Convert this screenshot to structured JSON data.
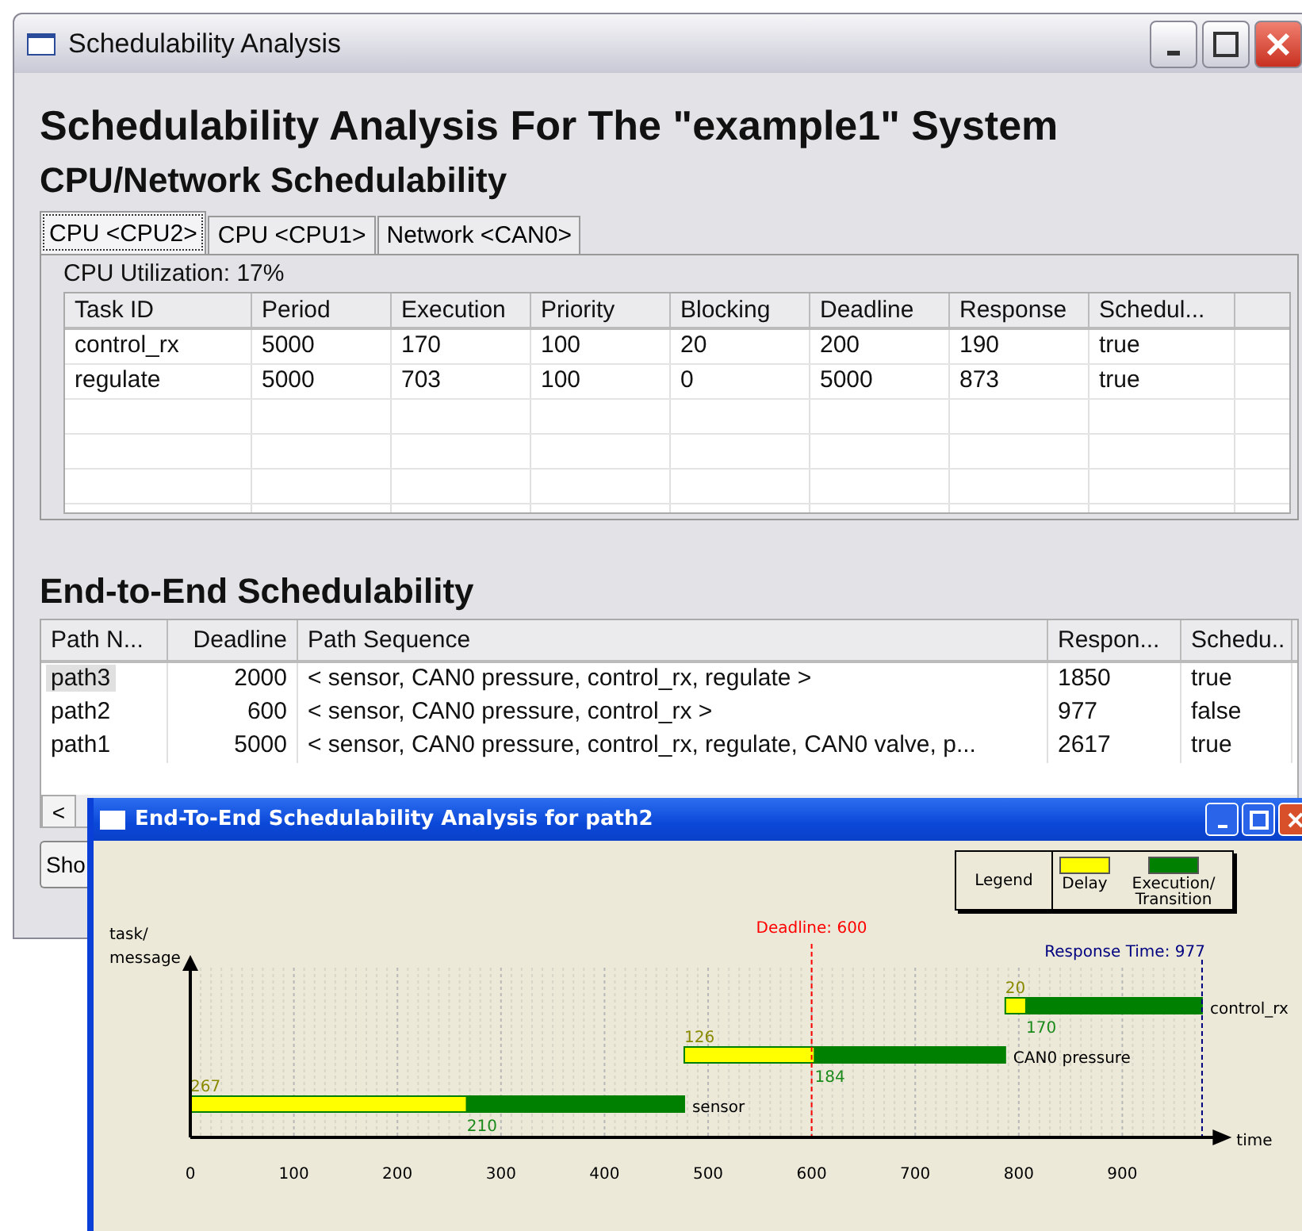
{
  "main_window": {
    "title": "Schedulability Analysis",
    "heading": "Schedulability Analysis For The \"example1\" System",
    "subheading": "CPU/Network Schedulability",
    "tabs": [
      {
        "label": "CPU <CPU2>",
        "selected": true
      },
      {
        "label": "CPU <CPU1>",
        "selected": false
      },
      {
        "label": "Network <CAN0>",
        "selected": false
      }
    ],
    "utilization": "CPU Utilization: 17%",
    "task_table": {
      "columns": [
        "Task ID",
        "Period",
        "Execution",
        "Priority",
        "Blocking",
        "Deadline",
        "Response",
        "Schedul..."
      ],
      "rows": [
        [
          "control_rx",
          "5000",
          "170",
          "100",
          "20",
          "200",
          "190",
          "true"
        ],
        [
          "regulate",
          "5000",
          "703",
          "100",
          "0",
          "5000",
          "873",
          "true"
        ]
      ]
    },
    "e2e_heading": "End-to-End Schedulability",
    "path_table": {
      "columns": [
        "Path N...",
        "Deadline",
        "Path Sequence",
        "Respon...",
        "Schedu.."
      ],
      "rows": [
        {
          "cells": [
            "path3",
            "2000",
            "< sensor, CAN0 pressure, control_rx, regulate >",
            "1850",
            "true"
          ],
          "selected": true
        },
        {
          "cells": [
            "path2",
            "600",
            "< sensor, CAN0 pressure, control_rx >",
            "977",
            "false"
          ],
          "selected": false
        },
        {
          "cells": [
            "path1",
            "5000",
            "< sensor, CAN0 pressure, control_rx, regulate, CAN0 valve, p...",
            "2617",
            "true"
          ],
          "selected": false
        }
      ]
    },
    "scroll_left": "<",
    "button": "Sho"
  },
  "chart_window": {
    "title": "End-To-End Schedulability Analysis for path2",
    "legend_title": "Legend",
    "gantt": {
      "xlabel": "time",
      "ylabel": "task/ message",
      "legend": [
        {
          "label": "Delay",
          "kind": "delay"
        },
        {
          "label": "Execution/ Transition",
          "kind": "execution"
        }
      ],
      "tasks": [
        {
          "name": "sensor",
          "delay": "267",
          "execution": "210"
        },
        {
          "name": "CAN0 pressure",
          "delay": "126",
          "execution": "184"
        },
        {
          "name": "control_rx",
          "delay": "20",
          "execution": "170"
        }
      ],
      "ticks": [
        "0",
        "100",
        "200",
        "300",
        "400",
        "500",
        "600",
        "700",
        "800",
        "900"
      ],
      "deadline": "Deadline: 600",
      "response": "Response Time: 977"
    }
  }
}
